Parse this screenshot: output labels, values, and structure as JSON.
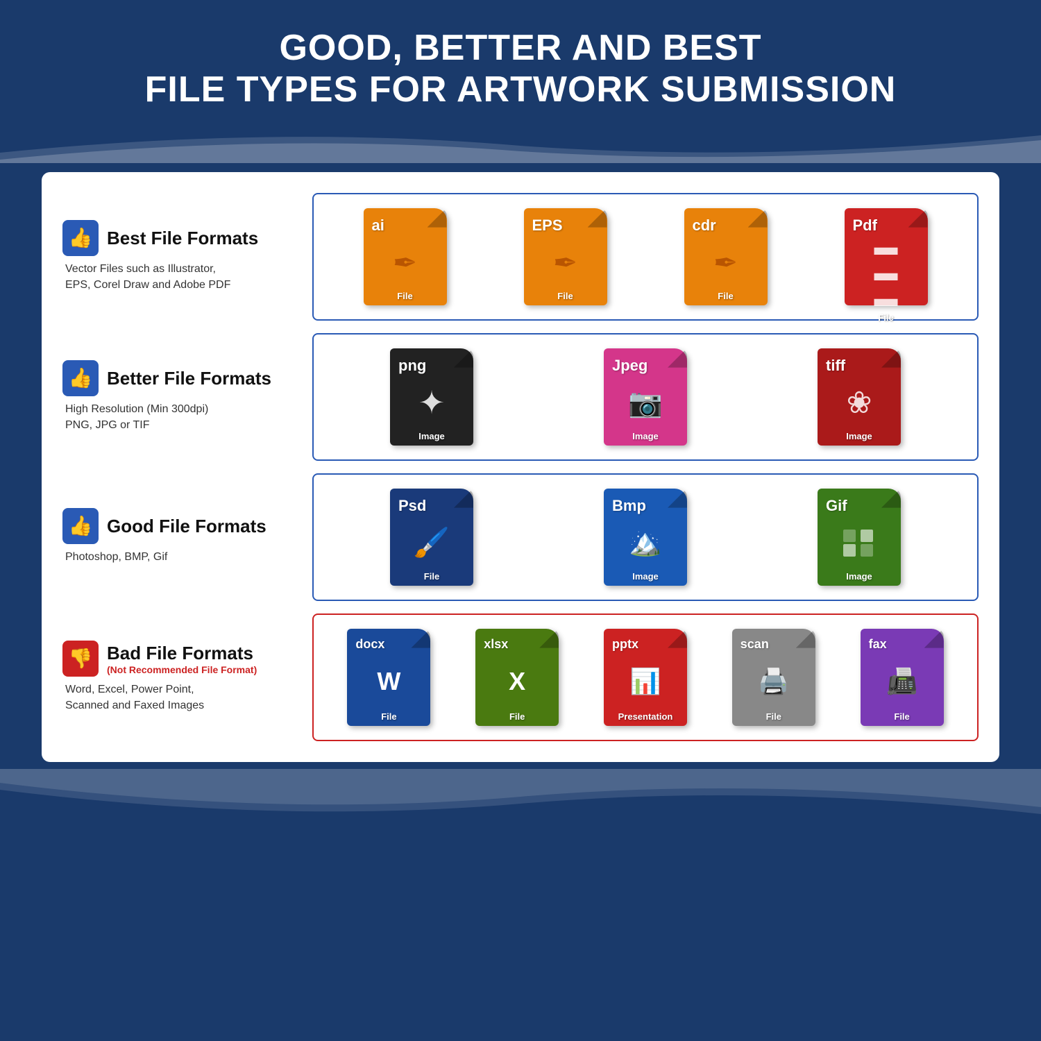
{
  "header": {
    "line1": "GOOD, BETTER AND BEST",
    "line2": "FILE TYPES FOR ARTWORK SUBMISSION"
  },
  "rows": [
    {
      "id": "best",
      "thumbs": "👍",
      "thumbs_type": "up",
      "label": "Best File Formats",
      "sublabel": "Vector Files such as Illustrator,\nEPS, Corel Draw and Adobe PDF",
      "is_bad": false,
      "icons": [
        {
          "ext": "ai",
          "color": "orange",
          "graphic": "✒️",
          "label": "File"
        },
        {
          "ext": "EPS",
          "color": "orange",
          "graphic": "✒️",
          "label": "File"
        },
        {
          "ext": "cdr",
          "color": "orange",
          "graphic": "✒️",
          "label": "File"
        },
        {
          "ext": "Pdf",
          "color": "red",
          "graphic": "📄",
          "label": "File"
        }
      ]
    },
    {
      "id": "better",
      "thumbs": "👍",
      "thumbs_type": "up",
      "label": "Better File Formats",
      "sublabel": "High Resolution (Min 300dpi)\nPNG, JPG or TIF",
      "is_bad": false,
      "icons": [
        {
          "ext": "png",
          "color": "black",
          "graphic": "✦",
          "label": "Image"
        },
        {
          "ext": "Jpeg",
          "color": "pink",
          "graphic": "📷",
          "label": "Image"
        },
        {
          "ext": "tiff",
          "color": "dark-red",
          "graphic": "❀",
          "label": "Image"
        }
      ]
    },
    {
      "id": "good",
      "thumbs": "👍",
      "thumbs_type": "up",
      "label": "Good File Formats",
      "sublabel": "Photoshop, BMP, Gif",
      "is_bad": false,
      "icons": [
        {
          "ext": "Psd",
          "color": "dark-navy",
          "graphic": "🖌️",
          "label": "File"
        },
        {
          "ext": "Bmp",
          "color": "blue",
          "graphic": "🏔️",
          "label": "Image"
        },
        {
          "ext": "Gif",
          "color": "green",
          "graphic": "▦",
          "label": "Image"
        }
      ]
    },
    {
      "id": "bad",
      "thumbs": "👎",
      "thumbs_type": "down",
      "label": "Bad File Formats",
      "sublabel_bad": "(Not Recommended File Format)",
      "sublabel": "Word, Excel, Power Point,\nScanned and Faxed Images",
      "is_bad": true,
      "icons": [
        {
          "ext": "docx",
          "color": "medium-blue",
          "graphic": "W",
          "label": "File"
        },
        {
          "ext": "xlsx",
          "color": "olive-green",
          "graphic": "X",
          "label": "File"
        },
        {
          "ext": "pptx",
          "color": "red",
          "graphic": "📊",
          "label": "Presentation"
        },
        {
          "ext": "scan",
          "color": "gray",
          "graphic": "🖨️",
          "label": "File"
        },
        {
          "ext": "fax",
          "color": "purple",
          "graphic": "📠",
          "label": "File"
        }
      ]
    }
  ]
}
